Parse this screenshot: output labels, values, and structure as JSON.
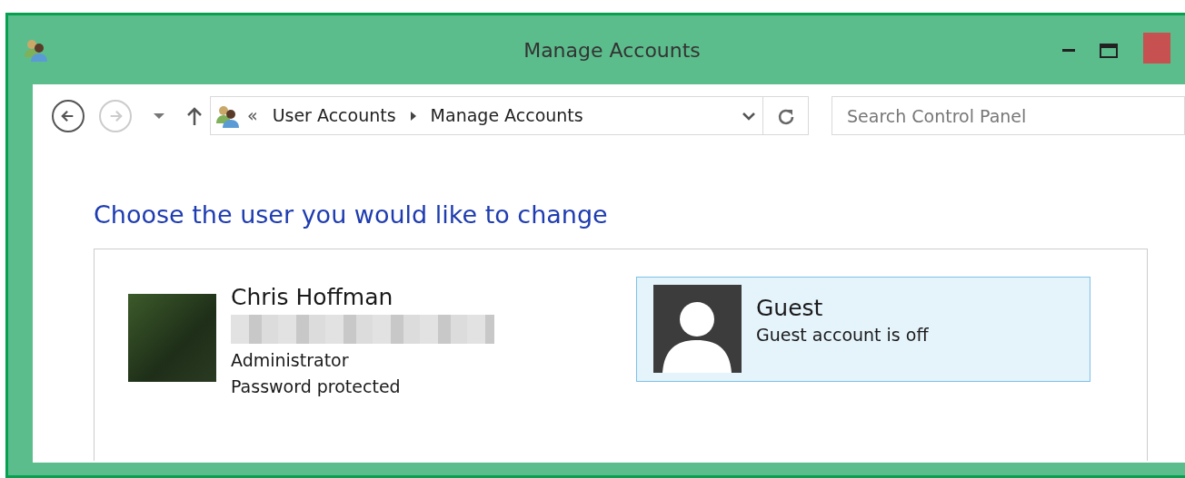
{
  "window": {
    "title": "Manage Accounts"
  },
  "nav_buttons": [
    {
      "kind": "back",
      "disabled": false
    },
    {
      "kind": "forward",
      "disabled": true
    }
  ],
  "address": {
    "overflow": "«",
    "breadcrumb": [
      {
        "label": "User Accounts"
      },
      {
        "label": "Manage Accounts"
      }
    ]
  },
  "search": {
    "placeholder": "Search Control Panel"
  },
  "heading": "Choose the user you would like to change",
  "accounts": [
    {
      "name": "Chris Hoffman",
      "kind": "photo",
      "redacted": true,
      "lines": [
        "Administrator",
        "Password protected"
      ],
      "selected": false
    },
    {
      "name": "Guest",
      "kind": "silhouette",
      "redacted": false,
      "lines": [
        "Guest account is off"
      ],
      "selected": true
    }
  ]
}
